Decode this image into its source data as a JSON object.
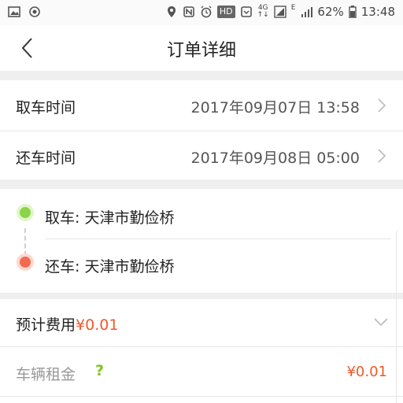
{
  "status_bar": {
    "network_4g_top": "4G",
    "network_4g_bottom": "↑↓",
    "network_e": "E",
    "hd": "HD",
    "battery_percent": "62%",
    "time": "13:48",
    "icons": [
      "gallery-icon",
      "sync-icon",
      "location-icon",
      "nfc-icon",
      "alarm-icon",
      "hd-badge",
      "message-icon",
      "signal-icon",
      "signal-icon",
      "battery-icon"
    ]
  },
  "header": {
    "title": "订单详细"
  },
  "times": {
    "pickup_label": "取车时间",
    "pickup_value": "2017年09月07日 13:58",
    "return_label": "还车时间",
    "return_value": "2017年09月08日 05:00"
  },
  "locations": {
    "pickup": "取车: 天津市勤俭桥",
    "return": "还车: 天津市勤俭桥",
    "pickup_color": "#8bd448",
    "return_color": "#f26b4f"
  },
  "fees": {
    "estimate_label": "预计费用",
    "estimate_value": "¥0.01",
    "rent_label": "车辆租金",
    "rent_help": "?",
    "rent_value": "¥0.01"
  },
  "colors": {
    "accent": "#f0592a",
    "green": "#7fc41f"
  }
}
